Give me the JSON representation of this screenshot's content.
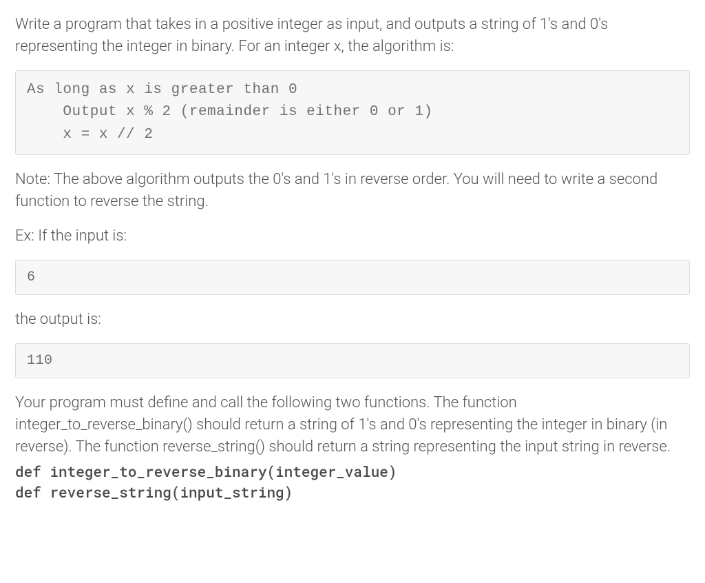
{
  "intro": "Write a program that takes in a positive integer as input, and outputs a string of 1's and 0's representing the integer in binary. For an integer x, the algorithm is:",
  "algorithm": "As long as x is greater than 0\n    Output x % 2 (remainder is either 0 or 1)\n    x = x // 2",
  "note": "Note: The above algorithm outputs the 0's and 1's in reverse order. You will need to write a second function to reverse the string.",
  "example_label": "Ex: If the input is:",
  "example_input": "6",
  "example_output_label": "the output is:",
  "example_output": "110",
  "instructions": "Your program must define and call the following two functions. The function integer_to_reverse_binary() should return a string of 1's and 0's representing the integer in binary (in reverse). The function reverse_string() should return a string representing the input string in reverse.",
  "sig1": "def integer_to_reverse_binary(integer_value)",
  "sig2": "def reverse_string(input_string)"
}
